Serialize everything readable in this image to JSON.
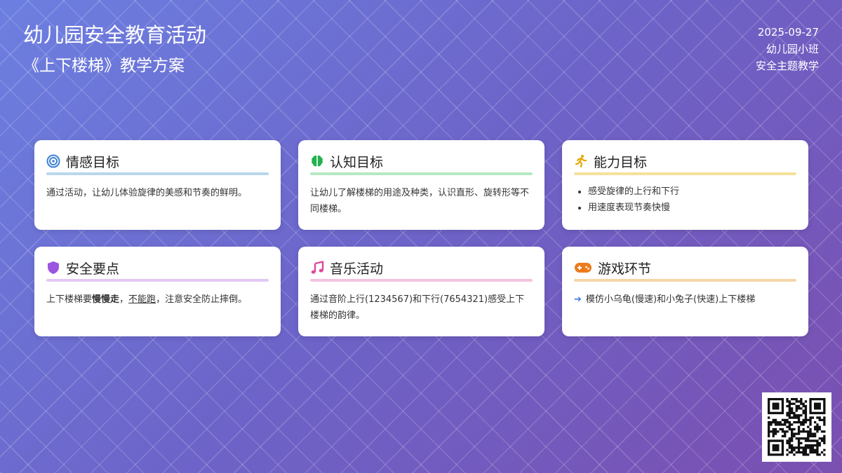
{
  "header": {
    "title": "幼儿园安全教育活动",
    "subtitle": "《上下楼梯》教学方案"
  },
  "meta": {
    "date": "2025-09-27",
    "class": "幼儿园小班",
    "theme": "安全主题教学"
  },
  "cards": [
    {
      "title": "情感目标",
      "icon": "target-icon",
      "accent": "#b8d7ec",
      "text": "通过活动，让幼儿体验旋律的美感和节奏的鲜明。"
    },
    {
      "title": "认知目标",
      "icon": "brain-icon",
      "accent": "#b5e8c3",
      "text": "让幼儿了解楼梯的用途及种类，认识直形、旋转形等不同楼梯。"
    },
    {
      "title": "能力目标",
      "icon": "running-icon",
      "accent": "#f5e29a",
      "items": [
        "感受旋律的上行和下行",
        "用速度表现节奏快慢"
      ]
    },
    {
      "title": "安全要点",
      "icon": "shield-icon",
      "accent": "#e3c8f2",
      "text_before": "上下楼梯要",
      "text_bold": "慢慢走",
      "text_mid": "，",
      "text_underline": "不能跑",
      "text_after": "，注意安全防止摔倒。"
    },
    {
      "title": "音乐活动",
      "icon": "music-note-icon",
      "accent": "#f4c3df",
      "text": "通过音阶上行(1234567)和下行(7654321)感受上下楼梯的韵律。"
    },
    {
      "title": "游戏环节",
      "icon": "gamepad-icon",
      "accent": "#f6d6a8",
      "text": "模仿小乌龟(慢速)和小兔子(快速)上下楼梯"
    }
  ],
  "colors": {
    "target": "#3b82d6",
    "brain": "#22b14c",
    "running": "#e6a700",
    "shield": "#9b55e0",
    "music": "#e0489a",
    "gamepad": "#ee7a1c",
    "arrow": "#3b7be8"
  }
}
